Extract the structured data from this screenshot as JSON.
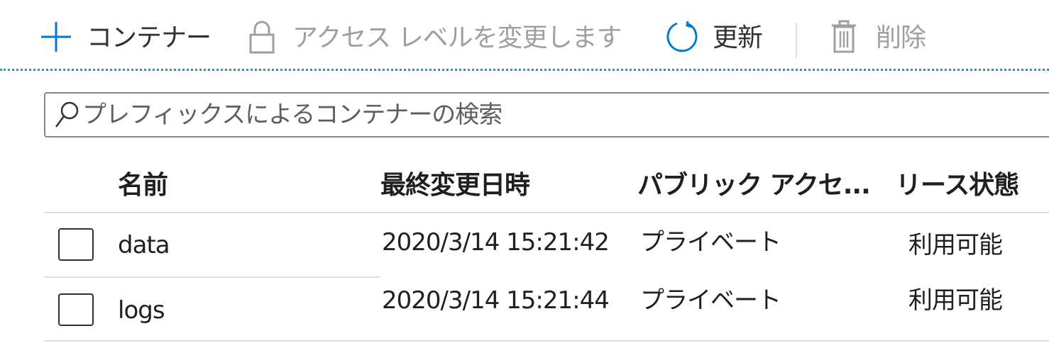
{
  "toolbar": {
    "add_container_label": "コンテナー",
    "change_access_label": "アクセス レベルを変更します",
    "refresh_label": "更新",
    "delete_label": "削除"
  },
  "search": {
    "placeholder": "プレフィックスによるコンテナーの検索",
    "value": ""
  },
  "table": {
    "headers": {
      "name": "名前",
      "modified": "最終変更日時",
      "public_access": "パブリック アクセ...",
      "lease_state": "リース状態"
    },
    "rows": [
      {
        "name": "data",
        "modified": "2020/3/14 15:21:42",
        "public_access": "プライベート",
        "lease_state": "利用可能"
      },
      {
        "name": "logs",
        "modified": "2020/3/14 15:21:44",
        "public_access": "プライベート",
        "lease_state": "利用可能"
      }
    ]
  },
  "colors": {
    "accent": "#0078d4",
    "disabled": "#a19f9d",
    "dotted_focus": "#0f9ed5"
  }
}
